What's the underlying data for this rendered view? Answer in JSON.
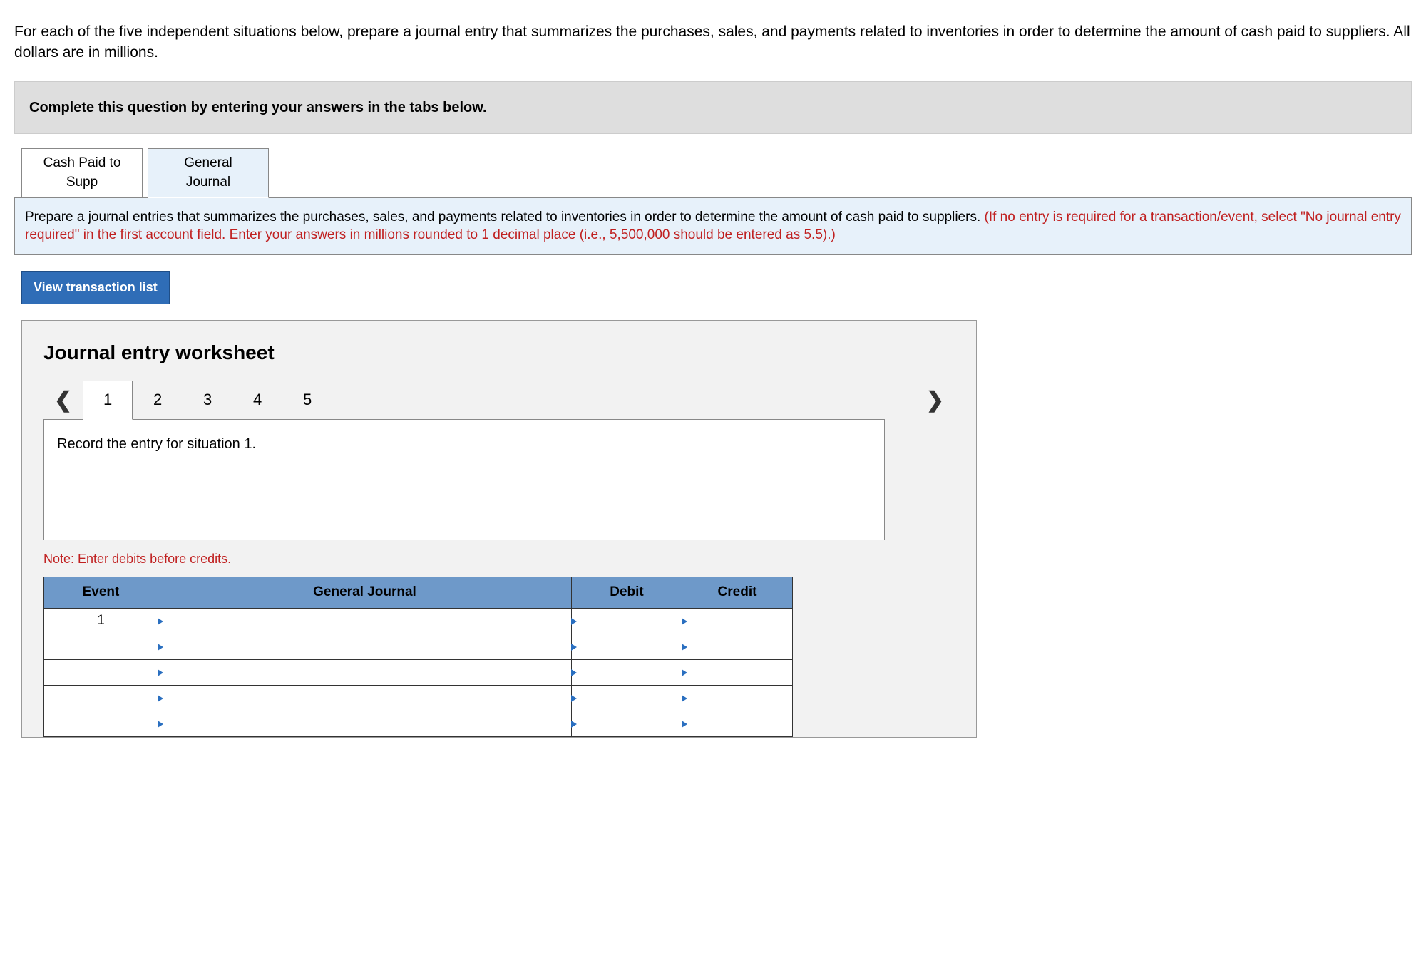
{
  "question": "For each of the five independent situations below, prepare a journal entry that summarizes the purchases, sales, and payments related to inventories in order to determine the amount of cash paid to suppliers. All dollars are in millions.",
  "instructionBar": "Complete this question by entering your answers in the tabs below.",
  "mainTabs": {
    "tab1": {
      "line1": "Cash Paid to",
      "line2": "Supp"
    },
    "tab2": {
      "line1": "General",
      "line2": "Journal"
    }
  },
  "panelInstruction": {
    "black": "Prepare a journal entries that summarizes the purchases, sales, and payments related to inventories in order to determine the amount of cash paid to suppliers. ",
    "red": "(If no entry is required for a transaction/event, select \"No journal entry required\" in the first account field. Enter your answers in millions rounded to 1 decimal place (i.e., 5,500,000 should be entered as 5.5).)"
  },
  "viewButton": "View transaction list",
  "worksheetTitle": "Journal entry worksheet",
  "entryNumbers": [
    "1",
    "2",
    "3",
    "4",
    "5"
  ],
  "recordPrompt": "Record the entry for situation 1.",
  "noteText": "Note: Enter debits before credits.",
  "table": {
    "headers": {
      "event": "Event",
      "gj": "General Journal",
      "debit": "Debit",
      "credit": "Credit"
    },
    "firstEvent": "1"
  }
}
